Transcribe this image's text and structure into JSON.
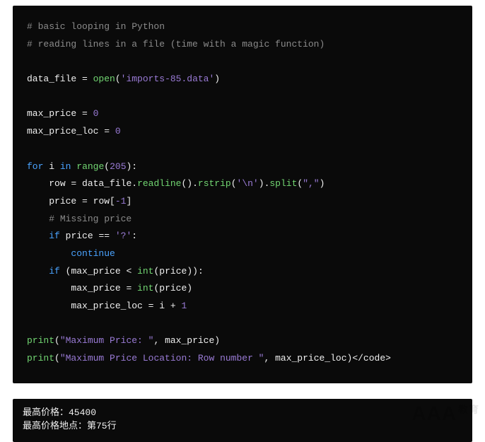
{
  "code": {
    "l1_comment": "# basic looping in Python",
    "l2_comment": "# reading lines in a file (time with a magic function)",
    "l4_ident": "data_file",
    "l4_eq": " = ",
    "l4_func": "open",
    "l4_paren_o": "(",
    "l4_str": "'imports-85.data'",
    "l4_paren_c": ")",
    "l6_ident": "max_price",
    "l6_eq": " = ",
    "l6_num": "0",
    "l7_ident": "max_price_loc",
    "l7_eq": " = ",
    "l7_num": "0",
    "l9_kw_for": "for",
    "l9_sp1": " ",
    "l9_i": "i",
    "l9_sp2": " ",
    "l9_kw_in": "in",
    "l9_sp3": " ",
    "l9_range": "range",
    "l9_paren_o": "(",
    "l9_num": "205",
    "l9_paren_c_colon": "):",
    "l10_indent": "    ",
    "l10_row": "row",
    "l10_eq": " = ",
    "l10_df": "data_file",
    "l10_dot1": ".",
    "l10_readline": "readline",
    "l10_pc1": "()",
    "l10_dot2": ".",
    "l10_rstrip": "rstrip",
    "l10_paren_o2": "(",
    "l10_str1": "'\\n'",
    "l10_paren_c2": ")",
    "l10_dot3": ".",
    "l10_split": "split",
    "l10_paren_o3": "(",
    "l10_str2": "\",\"",
    "l10_paren_c3": ")",
    "l11_indent": "    ",
    "l11_price": "price",
    "l11_eq": " = ",
    "l11_row": "row",
    "l11_bracket_o": "[",
    "l11_neg1": "-1",
    "l11_bracket_c": "]",
    "l12_indent": "    ",
    "l12_comment": "# Missing price",
    "l13_indent": "    ",
    "l13_if": "if",
    "l13_sp": " ",
    "l13_price": "price",
    "l13_eqeq": " == ",
    "l13_str": "'?'",
    "l13_colon": ":",
    "l14_indent": "        ",
    "l14_continue": "continue",
    "l15_indent": "    ",
    "l15_if": "if",
    "l15_sp": " ",
    "l15_paren_o": "(",
    "l15_mp": "max_price",
    "l15_lt": " < ",
    "l15_int": "int",
    "l15_paren_o2": "(",
    "l15_price": "price",
    "l15_paren_c2": ")",
    "l15_paren_c": ")",
    "l15_colon": ":",
    "l16_indent": "        ",
    "l16_mp": "max_price",
    "l16_eq": " = ",
    "l16_int": "int",
    "l16_paren_o": "(",
    "l16_price": "price",
    "l16_paren_c": ")",
    "l17_indent": "        ",
    "l17_mpl": "max_price_loc",
    "l17_eq": " = ",
    "l17_i": "i",
    "l17_plus": " + ",
    "l17_one": "1",
    "l19_print": "print",
    "l19_paren_o": "(",
    "l19_str": "\"Maximum Price: \"",
    "l19_comma": ", ",
    "l19_mp": "max_price",
    "l19_paren_c": ")",
    "l20_print": "print",
    "l20_paren_o": "(",
    "l20_str": "\"Maximum Price Location: Row number \"",
    "l20_comma": ", ",
    "l20_mpl": "max_price_loc",
    "l20_paren_c": ")",
    "l20_closecode": "</code>"
  },
  "output": {
    "line1": "最高价格：45400",
    "line2": "最高价格地点：第75行"
  },
  "watermark": {
    "main": "AAA",
    "sub": "教育"
  }
}
